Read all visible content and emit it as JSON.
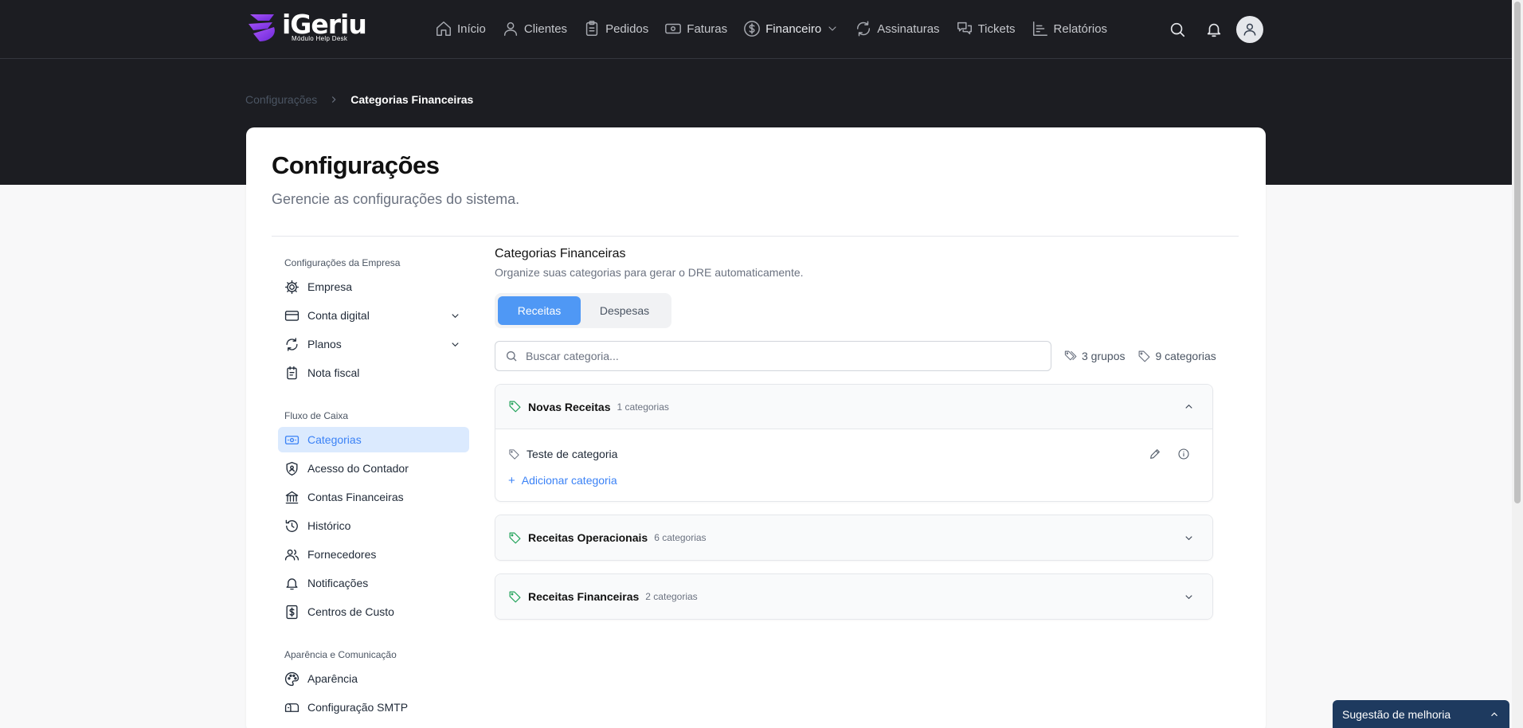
{
  "brand": {
    "name": "iGeriu",
    "subtitle": "Módulo Help Desk",
    "accent": "#a855f7"
  },
  "nav": {
    "items": [
      {
        "label": "Início",
        "icon": "home-icon"
      },
      {
        "label": "Clientes",
        "icon": "user-icon"
      },
      {
        "label": "Pedidos",
        "icon": "clipboard-icon"
      },
      {
        "label": "Faturas",
        "icon": "banknote-icon"
      },
      {
        "label": "Financeiro",
        "icon": "dollar-circle-icon"
      },
      {
        "label": "Assinaturas",
        "icon": "refresh-icon"
      },
      {
        "label": "Tickets",
        "icon": "chat-icon"
      },
      {
        "label": "Relatórios",
        "icon": "chart-icon"
      }
    ]
  },
  "breadcrumb": {
    "parent": "Configurações",
    "current": "Categorias Financeiras"
  },
  "page": {
    "title": "Configurações",
    "subtitle": "Gerencie as configurações do sistema."
  },
  "sidebar": {
    "groups": [
      {
        "title": "Configurações da Empresa",
        "items": [
          {
            "label": "Empresa",
            "icon": "gear-icon"
          },
          {
            "label": "Conta digital",
            "icon": "credit-card-icon"
          },
          {
            "label": "Planos",
            "icon": "refresh-icon"
          },
          {
            "label": "Nota fiscal",
            "icon": "receipt-icon"
          }
        ]
      },
      {
        "title": "Fluxo de Caixa",
        "items": [
          {
            "label": "Categorias",
            "icon": "banknote-icon"
          },
          {
            "label": "Acesso do Contador",
            "icon": "shield-icon"
          },
          {
            "label": "Contas Financeiras",
            "icon": "bank-icon"
          },
          {
            "label": "Histórico",
            "icon": "history-icon"
          },
          {
            "label": "Fornecedores",
            "icon": "users-icon"
          },
          {
            "label": "Notificações",
            "icon": "bell-icon"
          },
          {
            "label": "Centros de Custo",
            "icon": "dollar-square-icon"
          }
        ]
      },
      {
        "title": "Aparência e Comunicação",
        "items": [
          {
            "label": "Aparência",
            "icon": "palette-icon"
          },
          {
            "label": "Configuração SMTP",
            "icon": "mailbox-icon"
          }
        ]
      }
    ]
  },
  "section": {
    "title": "Categorias Financeiras",
    "subtitle": "Organize suas categorias para gerar o DRE automaticamente."
  },
  "tabs": {
    "income": "Receitas",
    "expense": "Despesas"
  },
  "search": {
    "placeholder": "Buscar categoria...",
    "value": ""
  },
  "stats": {
    "groups": "3 grupos",
    "categories": "9 categorias"
  },
  "category_groups": [
    {
      "name": "Novas Receitas",
      "count": "1 categorias",
      "expanded": true,
      "categories": [
        {
          "name": "Teste de categoria"
        }
      ],
      "add_label": "Adicionar categoria"
    },
    {
      "name": "Receitas Operacionais",
      "count": "6 categorias",
      "expanded": false
    },
    {
      "name": "Receitas Financeiras",
      "count": "2 categorias",
      "expanded": false
    }
  ],
  "feedback": {
    "label": "Sugestão de melhoria"
  },
  "colors": {
    "primary": "#4f98f5",
    "tag_green": "#22a35a",
    "header_bg": "#1c1d22"
  }
}
